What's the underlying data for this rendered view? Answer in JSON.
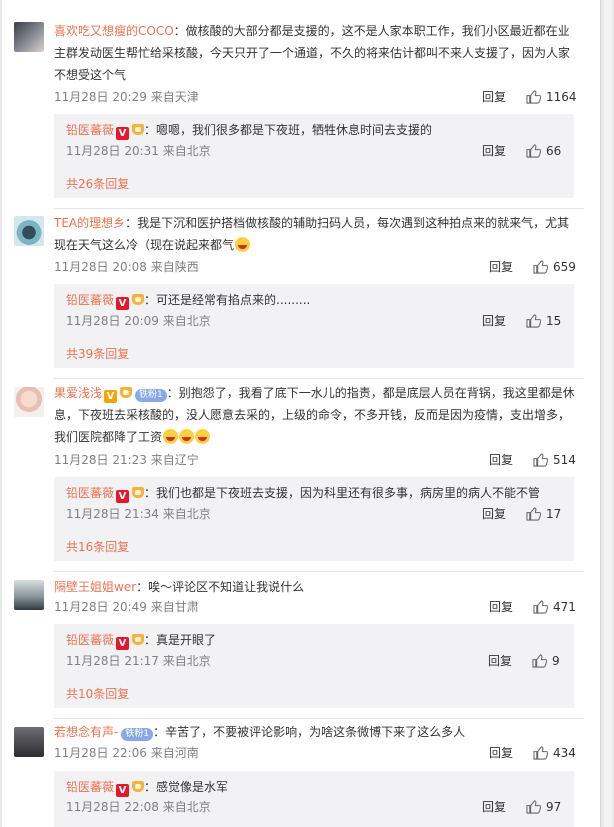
{
  "comments": [
    {
      "user": "喜欢吃又想瘦的COCO",
      "text_line1": "：做核酸的大部分都是支援的，这不是人家本职工作，我们小区最近都在业",
      "text_line2": "主群发动医生帮忙给采核酸，今天只开了一个通道，不久的将来估计都叫不来人支援了，因为人家",
      "text_line3": "不想受这个气",
      "meta": "11月28日 20:29 来自天津",
      "reply_label": "回复",
      "likes": "1164",
      "reply": {
        "user": "铅医蕃薇",
        "text": "：嗯嗯，我们很多都是下夜班，牺牲休息时间去支援的",
        "meta": "11月28日 20:31 来自北京",
        "reply_label": "回复",
        "likes": "66"
      },
      "more": "共26条回复"
    },
    {
      "user": "TEA的理想乡",
      "text_line1": "：我是下沉和医护搭档做核酸的辅助扫码人员，每次遇到这种拍点来的就来气，尤其",
      "text_line2": "现在天气这么冷（现在说起来都气",
      "meta": "11月28日 20:08 来自陕西",
      "reply_label": "回复",
      "likes": "659",
      "reply": {
        "user": "铅医蕃薇",
        "text": "：可还是经常有掐点来的.........",
        "meta": "11月28日 20:09 来自北京",
        "reply_label": "回复",
        "likes": "15"
      },
      "more": "共39条回复"
    },
    {
      "user": "果爱浅浅",
      "fans_badge": "铁粉1",
      "text_line1": "：别抱怨了，我看了底下一水儿的指责，都是底层人员在背锅，我这里都是休",
      "text_line2": "息，下夜班去采核酸的，没人愿意去采的，上级的命令，不多开钱，反而是因为疫情，支出增多，",
      "text_line3": "我们医院都降了工资",
      "meta": "11月28日 21:23 来自辽宁",
      "reply_label": "回复",
      "likes": "514",
      "reply": {
        "user": "铅医蕃薇",
        "text": "：我们也都是下夜班去支援，因为科里还有很多事，病房里的病人不能不管",
        "meta": "11月28日 21:34 来自北京",
        "reply_label": "回复",
        "likes": "17"
      },
      "more": "共16条回复"
    },
    {
      "user": "隔壁王姐姐wer",
      "text_line1": "：唉～评论区不知道让我说什么",
      "meta": "11月28日 20:49 来自甘肃",
      "reply_label": "回复",
      "likes": "471",
      "reply": {
        "user": "铅医蕃薇",
        "text": "：真是开眼了",
        "meta": "11月28日 21:17 来自北京",
        "reply_label": "回复",
        "likes": "9"
      },
      "more": "共10条回复"
    },
    {
      "user": "若想念有声-",
      "fans_badge": "铁粉1",
      "text_line1": "：辛苦了，不要被评论影响，为啥这条微博下来了这么多人",
      "meta": "11月28日 22:06 来自河南",
      "reply_label": "回复",
      "likes": "434",
      "reply": {
        "user": "铅医蕃薇",
        "text": "：感觉像是水军",
        "meta": "11月28日 22:08 来自北京",
        "reply_label": "回复",
        "likes": "97"
      }
    }
  ],
  "colors": {
    "username": "#eb7350",
    "meta": "#808080",
    "reply_bg": "#f2f2f5",
    "badge_orange": "#f7a300",
    "badge_red": "#e6162d"
  },
  "icons": {
    "like": "thumbs-up-icon",
    "vip": "v-badge-icon",
    "crown": "crown-icon",
    "emoji": "laugh-emoji-icon"
  }
}
